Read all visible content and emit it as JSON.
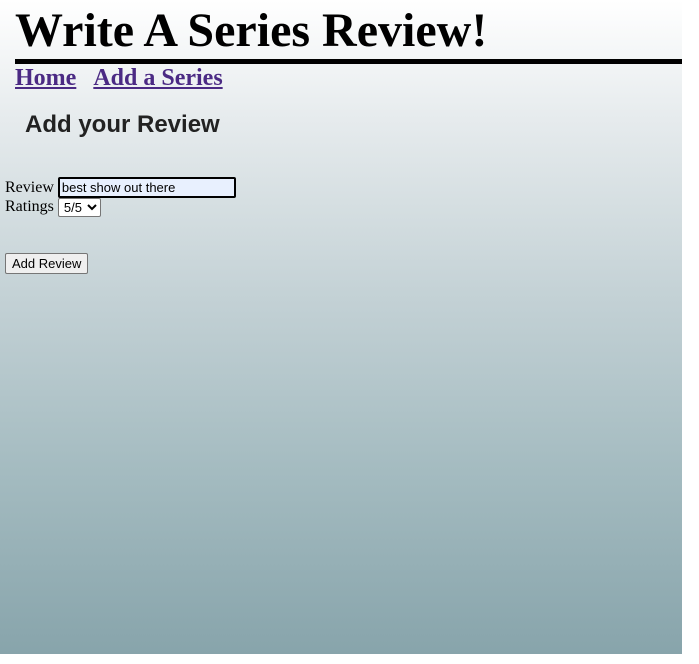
{
  "header": {
    "title": "Write A Series Review!"
  },
  "nav": {
    "home_label": "Home",
    "add_series_label": "Add a Series"
  },
  "form": {
    "heading": "Add your Review",
    "review_label": "Review",
    "review_value": "best show out there",
    "ratings_label": "Ratings",
    "ratings_selected": "5/5",
    "submit_label": "Add Review"
  },
  "colors": {
    "link": "#4b2a84",
    "input_background": "#e8f0fe",
    "gradient_top": "#ffffff",
    "gradient_bottom": "#86a3aa"
  }
}
